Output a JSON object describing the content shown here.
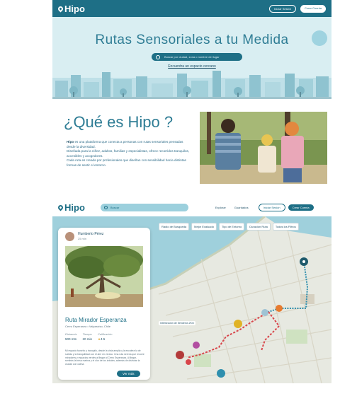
{
  "brand": {
    "name": "Hipo"
  },
  "hero": {
    "nav": {
      "login": "Iniciar Sesión",
      "signup": "Crear Cuenta"
    },
    "title": "Rutas Sensoriales a tu Medida",
    "search_placeholder": "Buscar por ciudad, zona o nombre del lugar",
    "link": "Encuentra un espacio cercano"
  },
  "about": {
    "title": "¿Qué es Hipo ?",
    "brand_word": "Hipo",
    "p1": "es una plataforma que conecta a personas con rutas sensoriales pensadas desde la diversidad.",
    "p2": "Diseñada para la niñez, adultos, familias y especialistas, ofrece recorridos tranquilos, accesibles y acogedores.",
    "p3": "Cada ruta es creada por profesionales que diseñan con sensibilidad hacia distintas formas de sentir el entorno."
  },
  "app": {
    "search_placeholder": "Buscar",
    "nav_links": [
      "Explorar",
      "Guardados"
    ],
    "login": "Iniciar Sesión",
    "signup": "Crear Cuenta",
    "filters": [
      "Radio de Búsqueda",
      "Mejor Evaluado",
      "Tipo de Entorno",
      "Duración Ruta",
      "Todos los Filtros"
    ],
    "map_label": "Intersección de Senderos 2Km",
    "card": {
      "user": "Humberto Pérez",
      "time": "25 min",
      "title": "Ruta Mirador Esperanza",
      "location": "Cerro Esperanza • Valparaíso, Chile",
      "stats": [
        {
          "label": "Distancia",
          "value": "500 mts"
        },
        {
          "label": "Tiempo",
          "value": "20 min"
        },
        {
          "label": "Calificación",
          "value": "4.5"
        }
      ],
      "description": "Mi espacio favorito y tranquilo, desde la vista amplia y la escalera la de subida y la tranquilidad con el aire en verano. Una ruta serena que recorre miradores y espacios verdes al llegar al Cerro Esperanza. Al llegar, sentirás la brisa marina y el olor de los árboles, además de disfrutar la ciudad con calma.",
      "button": "Ver más"
    }
  },
  "colors": {
    "primary": "#1e6f86",
    "accent": "#2f7d95",
    "route_red": "#d8454a",
    "route_blue": "#2f8fae"
  }
}
